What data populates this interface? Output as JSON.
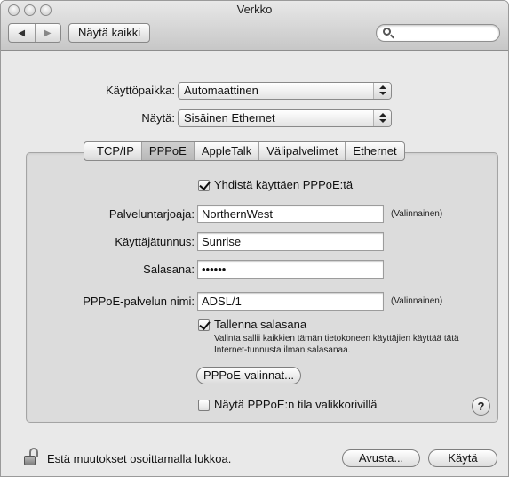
{
  "window": {
    "title": "Verkko"
  },
  "toolbar": {
    "back_label": "◀",
    "forward_label": "▶",
    "show_all_label": "Näytä kaikki",
    "search_value": ""
  },
  "location": {
    "label": "Käyttöpaikka:",
    "value": "Automaattinen"
  },
  "show": {
    "label": "Näytä:",
    "value": "Sisäinen Ethernet"
  },
  "tabs": [
    {
      "label": "TCP/IP",
      "active": false
    },
    {
      "label": "PPPoE",
      "active": true
    },
    {
      "label": "AppleTalk",
      "active": false
    },
    {
      "label": "Välipalvelimet",
      "active": false
    },
    {
      "label": "Ethernet",
      "active": false
    }
  ],
  "pppoe": {
    "connect_checkbox": {
      "label": "Yhdistä käyttäen PPPoE:tä",
      "checked": true
    },
    "provider": {
      "label": "Palveluntarjoaja:",
      "value": "NorthernWest",
      "optional": "(Valinnainen)"
    },
    "account": {
      "label": "Käyttäjätunnus:",
      "value": "Sunrise"
    },
    "password": {
      "label": "Salasana:",
      "value": "••••••"
    },
    "service_name": {
      "label": "PPPoE-palvelun nimi:",
      "value": "ADSL/1",
      "optional": "(Valinnainen)"
    },
    "save_password": {
      "label": "Tallenna salasana",
      "checked": true
    },
    "save_note": "Valinta sallii kaikkien tämän tietokoneen käyttäjien käyttää tätä Internet-tunnusta ilman salasanaa.",
    "options_button": "PPPoE-valinnat...",
    "menu_status": {
      "label": "Näytä PPPoE:n tila valikkorivillä",
      "checked": false
    },
    "help_label": "?"
  },
  "footer": {
    "lock_text": "Estä muutokset osoittamalla lukkoa.",
    "assist_button": "Avusta...",
    "apply_button": "Käytä"
  }
}
